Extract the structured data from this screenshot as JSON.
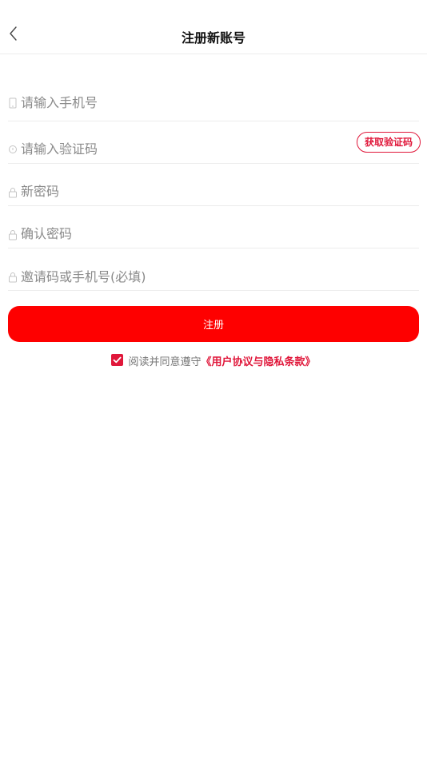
{
  "header": {
    "title": "注册新账号"
  },
  "form": {
    "phone_placeholder": "请输入手机号",
    "code_placeholder": "请输入验证码",
    "get_code_label": "获取验证码",
    "password_placeholder": "新密码",
    "confirm_placeholder": "确认密码",
    "invite_placeholder": "邀请码或手机号(必填)",
    "submit_label": "注册"
  },
  "agreement": {
    "checked": true,
    "text": "阅读并同意遵守",
    "link": "《用户协议与隐私条款》"
  },
  "colors": {
    "accent": "#e0173a",
    "primary_button": "#fe0000"
  }
}
